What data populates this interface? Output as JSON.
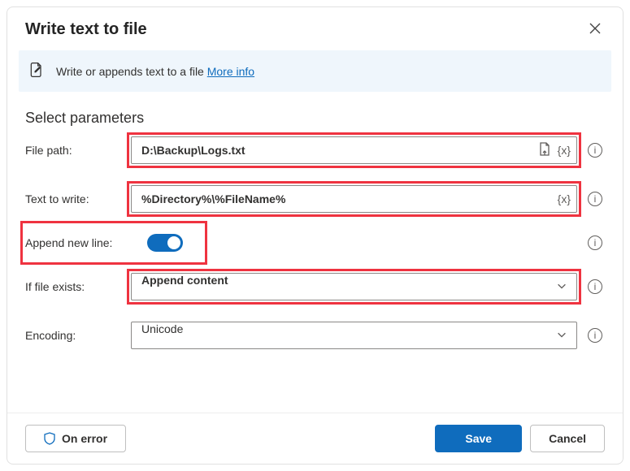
{
  "header": {
    "title": "Write text to file"
  },
  "banner": {
    "text": "Write or appends text to a file",
    "more": "More info"
  },
  "section": "Select parameters",
  "labels": {
    "filePath": "File path:",
    "textToWrite": "Text to write:",
    "appendNewLine": "Append new line:",
    "ifFileExists": "If file exists:",
    "encoding": "Encoding:"
  },
  "values": {
    "filePath": "D:\\Backup\\Logs.txt",
    "textToWrite": "%Directory%\\%FileName%",
    "appendNewLine": true,
    "ifFileExists": "Append content",
    "encoding": "Unicode"
  },
  "tokens": {
    "var": "{x}"
  },
  "footer": {
    "onError": "On error",
    "save": "Save",
    "cancel": "Cancel"
  }
}
